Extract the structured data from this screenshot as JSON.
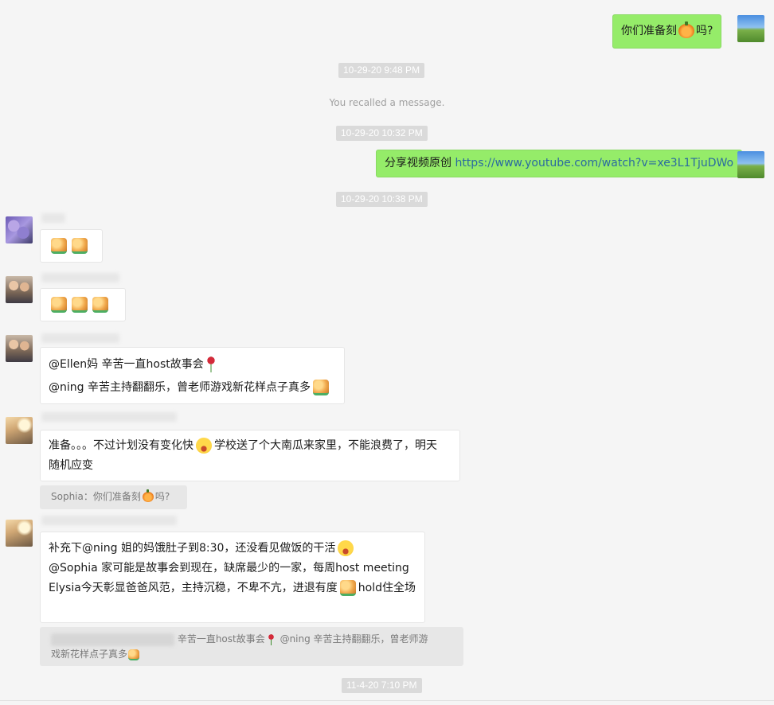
{
  "timestamps": {
    "t1": "10-29-20 9:48 PM",
    "t2": "10-29-20 10:32 PM",
    "t3": "10-29-20 10:38 PM",
    "t4": "11-4-20 7:10 PM"
  },
  "system": {
    "recalled": "You recalled a message."
  },
  "messages": {
    "m1": {
      "text_before": "你们准备刻",
      "emoji": "pumpkin",
      "text_after": "吗?"
    },
    "m2": {
      "text": "分享视频原创",
      "link": "https://www.youtube.com/watch?v=xe3L1TjuDWo"
    },
    "m3": {
      "emoji": [
        "thumbs-up",
        "thumbs-up"
      ]
    },
    "m4": {
      "emoji": [
        "thumbs-up",
        "thumbs-up",
        "thumbs-up"
      ]
    },
    "m5": {
      "line1": "@Ellen妈 辛苦一直host故事会",
      "line1_emoji": "rose",
      "line2": "@ning 辛苦主持翻翻乐，曾老师游戏新花样点子真多",
      "line2_emoji": "thumbs-up"
    },
    "m6": {
      "part1": "准备。。。不过计划没有变化快",
      "emoji": "tears-of-joy",
      "part2": "学校送了个大南瓜来家里，不能浪费了，明天",
      "line2": "随机应变",
      "quote_before": "Sophia：你们准备刻",
      "quote_emoji": "pumpkin",
      "quote_after": "吗?"
    },
    "m7": {
      "line1": "补充下@ning 姐的妈饿肚子到8:30，还没看见做饭的干活",
      "line1_emoji": "tears-of-joy",
      "line2": "@Sophia 家可能是故事会到现在，缺席最少的一家，每周host meeting",
      "line3_before": "Elysia今天彰显爸爸风范，主持沉稳，不卑不亢，进退有度",
      "line3_emoji": "thumbs-up",
      "line3_after": "hold住全场",
      "quote_line1": "辛苦一直host故事会",
      "quote_line1_emoji": "rose",
      "quote_line1_after": "@ning 辛苦主持翻翻乐，曾老师游",
      "quote_line2": "戏新花样点子真多",
      "quote_line2_emoji": "thumbs-up"
    }
  },
  "colors": {
    "background": "#f5f5f5",
    "sent_bubble": "#95ec69",
    "received_bubble": "#ffffff",
    "timestamp_bg": "#dadada",
    "quote_bg": "#e7e7e7",
    "link": "#3a6ea8"
  }
}
